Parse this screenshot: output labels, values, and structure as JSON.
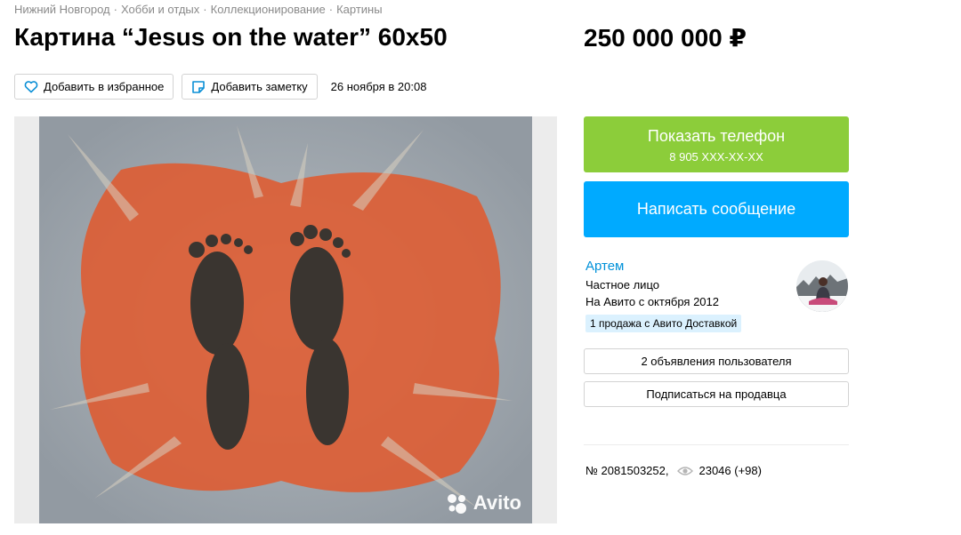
{
  "breadcrumb": {
    "items": [
      "Нижний Новгород",
      "Хобби и отдых",
      "Коллекционирование",
      "Картины"
    ],
    "separator": "·"
  },
  "listing": {
    "title": "Картина “Jesus on the water” 60x50",
    "price": "250 000 000 ₽",
    "date": "26 ноября в 20:08",
    "number": "№ 2081503252,",
    "views": "23046 (+98)"
  },
  "toolbar": {
    "favorite_label": "Добавить в избранное",
    "note_label": "Добавить заметку"
  },
  "photo": {
    "watermark": "Avito"
  },
  "contact": {
    "phone_label": "Показать телефон",
    "phone_masked": "8 905 XXX-XX-XX",
    "message_label": "Написать сообщение"
  },
  "seller": {
    "name": "Артем",
    "type": "Частное лицо",
    "since": "На Авито с октября 2012",
    "badge": "1 продажа с Авито Доставкой",
    "listings_button": "2 объявления пользователя",
    "subscribe_button": "Подписаться на продавца"
  },
  "colors": {
    "green_button": "#8ccd3a",
    "blue_button": "#00aaff",
    "link": "#0091d9",
    "badge_bg": "#dbf1fe"
  },
  "icons": {
    "favorite": "heart-icon",
    "note": "note-icon",
    "views": "eye-icon"
  }
}
